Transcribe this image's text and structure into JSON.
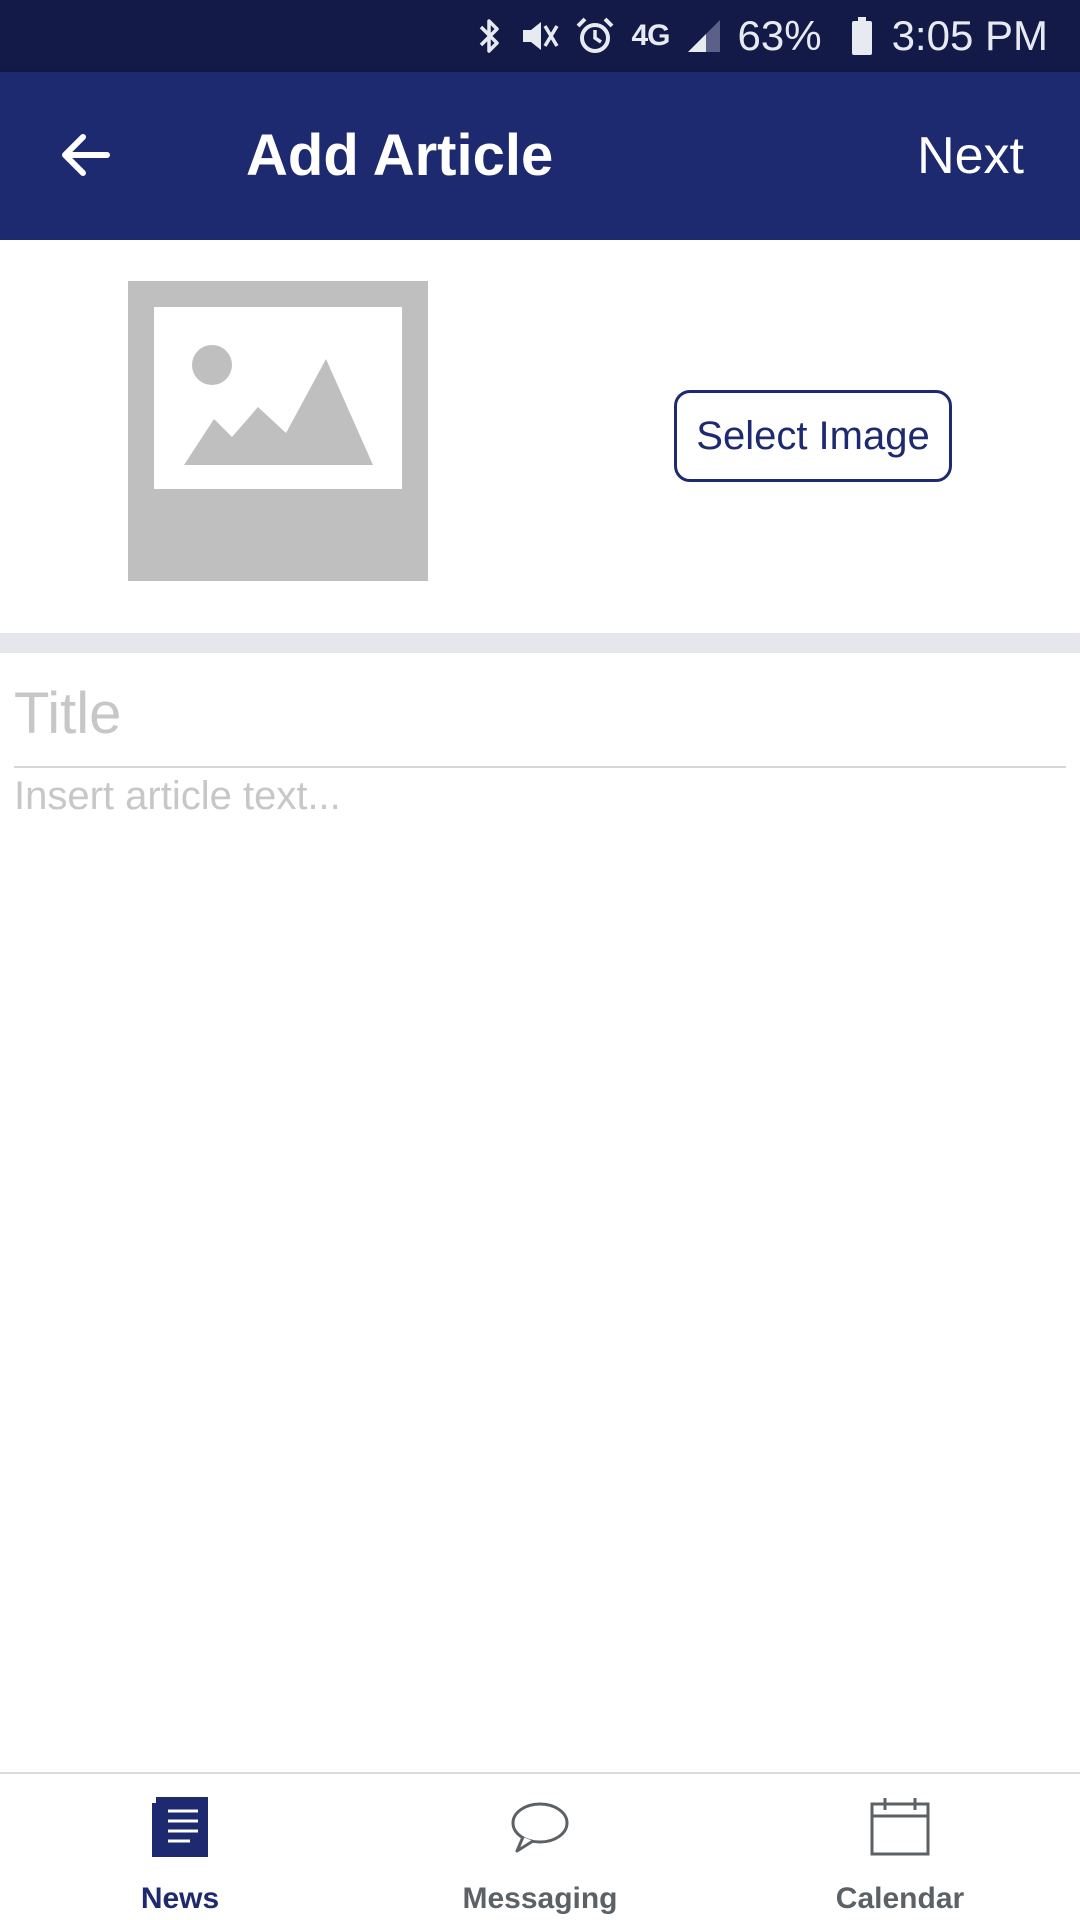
{
  "status_bar": {
    "icons": [
      "bluetooth-icon",
      "vibrate-mute-icon",
      "alarm-icon",
      "4g-lte-icon",
      "signal-icon",
      "battery-icon"
    ],
    "network_label": "4G",
    "battery_percent": "63%",
    "time": "3:05 PM"
  },
  "app_bar": {
    "back_icon": "arrow-left-icon",
    "title": "Add Article",
    "next_label": "Next"
  },
  "image_section": {
    "placeholder_icon": "image-placeholder-icon",
    "select_image_label": "Select Image"
  },
  "form": {
    "title_placeholder": "Title",
    "title_value": "",
    "body_placeholder": "Insert article text...",
    "body_value": ""
  },
  "bottom_nav": {
    "items": [
      {
        "label": "News",
        "icon": "news-icon",
        "active": true
      },
      {
        "label": "Messaging",
        "icon": "chat-bubble-icon",
        "active": false
      },
      {
        "label": "Calendar",
        "icon": "calendar-icon",
        "active": false
      }
    ]
  },
  "colors": {
    "status_bar": "#141a47",
    "app_bar": "#1e2a6f",
    "accent": "#1e2a6f",
    "placeholder_text": "#c7c7c7",
    "inactive_nav": "#5c6166"
  }
}
